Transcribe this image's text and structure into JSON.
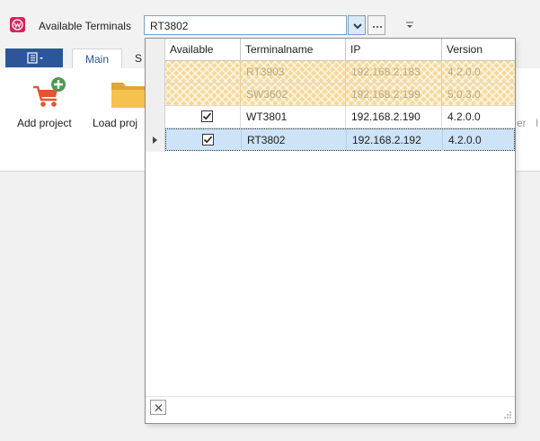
{
  "header": {
    "app_icon": "app-logo-icon",
    "terminal_label": "Available Terminals",
    "terminal_value": "RT3802",
    "dropdown_icon": "chevron-down-icon",
    "more_icon": "ellipsis-icon",
    "quick_access_icon": "customize-quick-access-icon"
  },
  "ribbon": {
    "file_tab_icon": "file-menu-icon",
    "tabs": [
      {
        "label": "Main",
        "active": true
      },
      {
        "label": "S"
      }
    ],
    "buttons": [
      {
        "label": "Add project",
        "icon": "add-project-cart-icon"
      },
      {
        "label": "Load proj",
        "icon": "folder-icon"
      }
    ],
    "partial_right_text": [
      "er",
      "I"
    ]
  },
  "grid": {
    "columns": [
      "Available",
      "Terminalname",
      "IP",
      "Version"
    ],
    "rows": [
      {
        "available": false,
        "name": "RT3903",
        "ip": "192.168.2.183",
        "version": "4.2.0.0",
        "disabled": true
      },
      {
        "available": false,
        "name": "SW3602",
        "ip": "192.168.2.199",
        "version": "5.0.3.0",
        "disabled": true
      },
      {
        "available": true,
        "name": "WT3801",
        "ip": "192.168.2.190",
        "version": "4.2.0.0"
      },
      {
        "available": true,
        "name": "RT3802",
        "ip": "192.168.2.192",
        "version": "4.2.0.0",
        "selected": true
      }
    ],
    "clear_icon": "close-icon",
    "resize_icon": "resize-grip-icon"
  },
  "colors": {
    "brand": "#d9235b",
    "file_tab": "#2b579a",
    "disabled_row": "#f6d99a",
    "selected_row": "#cde3f7"
  }
}
